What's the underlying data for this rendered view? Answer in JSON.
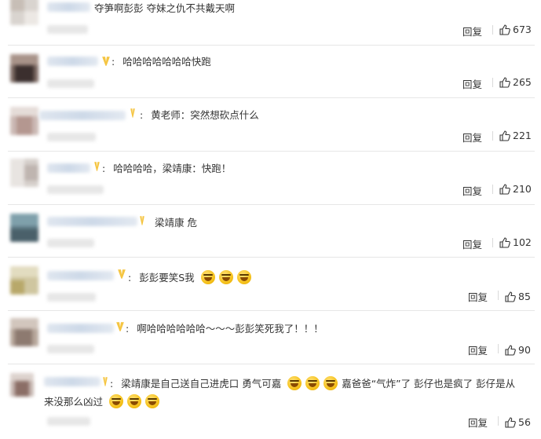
{
  "reply_label": "回复",
  "icons": {
    "like": "thumbs-up-icon",
    "emoji": "laughing-crying-emoji-icon"
  },
  "comments": [
    {
      "text": "夺笋啊彭彭 夺妹之仇不共戴天啊",
      "likes": "673"
    },
    {
      "text": "哈哈哈哈哈哈哈快跑",
      "likes": "265"
    },
    {
      "text": "黄老师：突然想砍点什么",
      "likes": "221"
    },
    {
      "text": "哈哈哈哈，梁靖康：快跑！",
      "likes": "210"
    },
    {
      "text": "梁靖康 危",
      "likes": "102"
    },
    {
      "text": "彭彭要笑S我",
      "likes": "85"
    },
    {
      "text": "啊哈哈哈哈哈哈～～～彭彭笑死我了！！！",
      "likes": "90"
    },
    {
      "text_part1": "梁靖康是自己送自己进虎口 勇气可嘉",
      "text_part2": "嘉爸爸“气炸”了 彭仔也是疯了 彭仔是从",
      "text_line2": "来没那么凶过",
      "likes": "56"
    }
  ]
}
